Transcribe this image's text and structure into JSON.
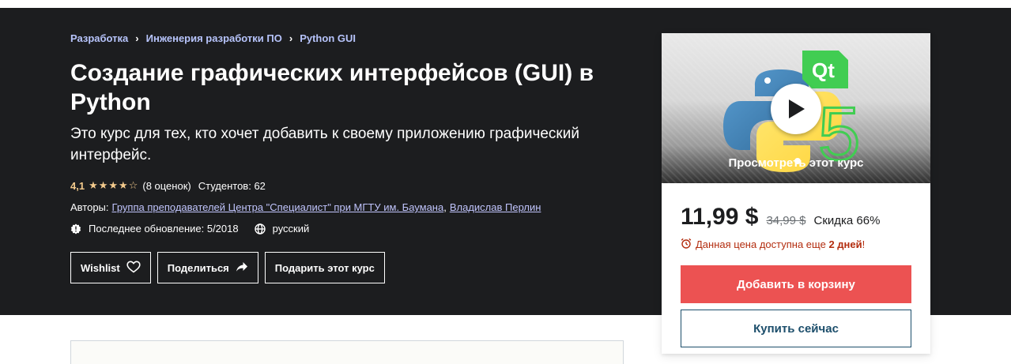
{
  "breadcrumb": [
    "Разработка",
    "Инженерия разработки ПО",
    "Python GUI"
  ],
  "course": {
    "title": "Создание графических интерфейсов (GUI) в Python",
    "subtitle": "Это курс для тех, кто хочет добавить к своему приложению графический интерфейс.",
    "rating": "4,1",
    "stars": "★★★★☆",
    "rating_value": 4.1,
    "rating_count": "(8 оценок)",
    "students": "Студентов: 62",
    "authors_label": "Авторы:",
    "authors": [
      "Группа преподавателей Центра \"Специалист\" при МГТУ им. Баумана",
      "Владислав Перлин"
    ],
    "authors_separator": ",",
    "last_update": "Последнее обновление: 5/2018",
    "language": "русский"
  },
  "actions": {
    "wishlist": "Wishlist",
    "share": "Поделиться",
    "gift": "Подарить этот курс"
  },
  "sidebar": {
    "preview_label": "Просмотреть этот курс",
    "price": "11,99 $",
    "old_price": "34,99 $",
    "discount": "Скидка 66%",
    "timer_text": "Данная цена доступна еще ",
    "timer_days": "2 дней",
    "timer_end": "!",
    "add_to_cart": "Добавить в корзину",
    "buy_now": "Купить сейчас"
  },
  "colors": {
    "hero_bg": "#1c1d1f",
    "link": "#c0c4fc",
    "star": "#f3ca8c",
    "cart_button": "#ec5252",
    "timer": "#b32d0f"
  },
  "icons": [
    "chevron-right-icon",
    "star-icon",
    "update-badge-icon",
    "globe-icon",
    "heart-icon",
    "share-arrow-icon",
    "play-icon",
    "alarm-clock-icon"
  ]
}
